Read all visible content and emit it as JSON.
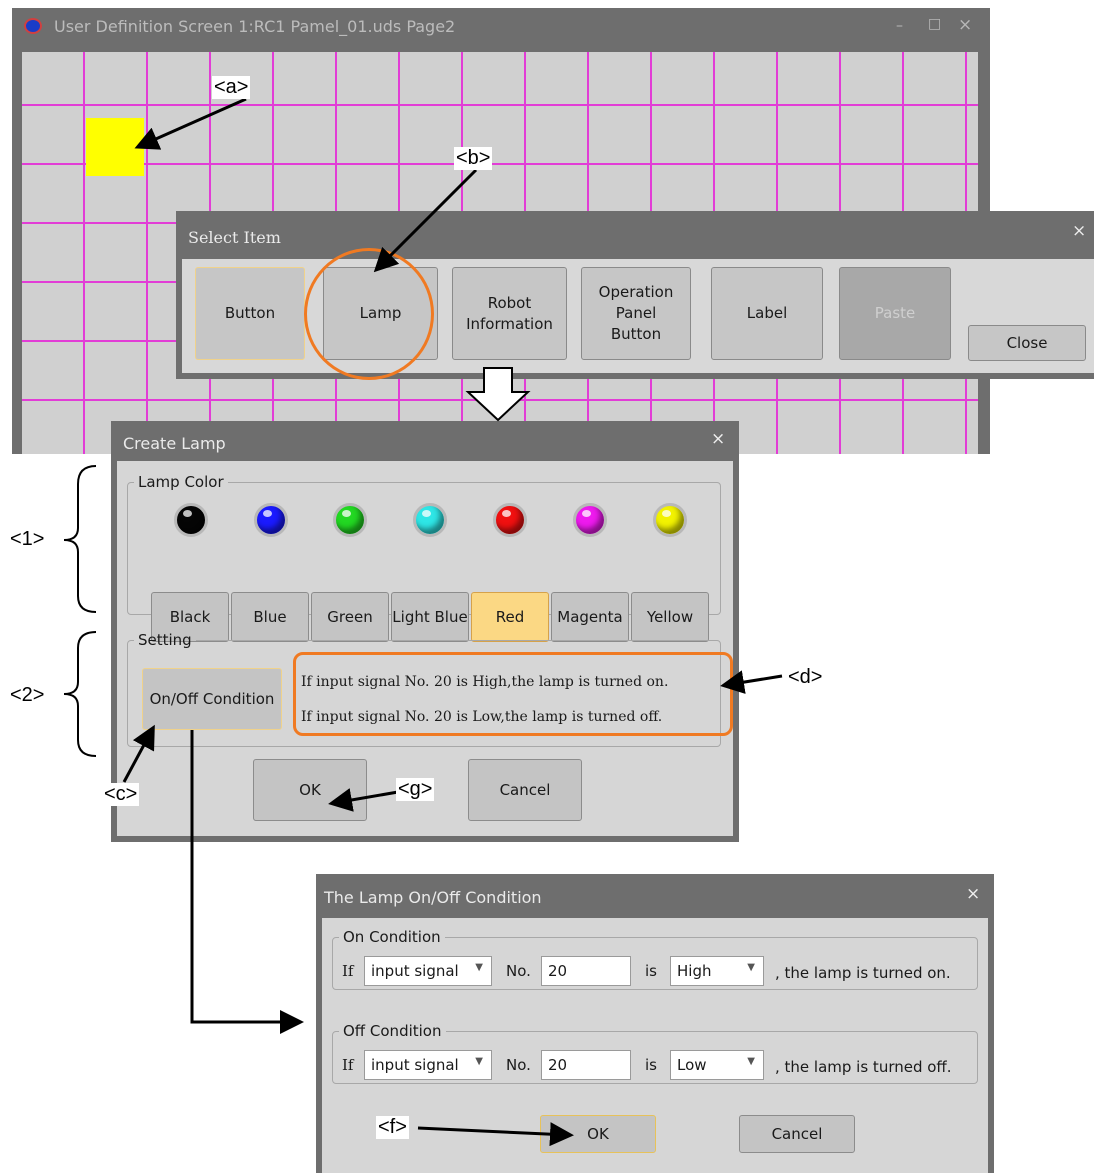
{
  "main_window": {
    "title": "User Definition Screen 1:RC1 Pamel_01.uds Page2",
    "controls": [
      "–",
      "□",
      "×"
    ]
  },
  "select_item": {
    "title": "Select Item",
    "close_x": "×",
    "buttons": [
      "Button",
      "Lamp",
      "Robot\nInformation",
      "Operation\nPanel\nButton",
      "Label",
      "Paste"
    ],
    "close": "Close"
  },
  "create_lamp": {
    "title": "Create Lamp",
    "close_x": "×",
    "lamp_color_legend": "Lamp Color",
    "colors": [
      {
        "label": "Black",
        "hex": "#050505"
      },
      {
        "label": "Blue",
        "hex": "#1a1aff"
      },
      {
        "label": "Green",
        "hex": "#22d822"
      },
      {
        "label": "Light Blue",
        "hex": "#2ee6e6"
      },
      {
        "label": "Red",
        "hex": "#f01010"
      },
      {
        "label": "Magenta",
        "hex": "#ee1aee"
      },
      {
        "label": "Yellow",
        "hex": "#f2f200"
      }
    ],
    "selected_color": "Red",
    "setting_legend": "Setting",
    "on_off_button": "On/Off Condition",
    "desc_on": "If input signal No. 20 is High,the lamp is turned on.",
    "desc_off": "If input signal No. 20 is Low,the lamp is turned off.",
    "ok": "OK",
    "cancel": "Cancel"
  },
  "condition": {
    "title": "The Lamp On/Off Condition",
    "close_x": "×",
    "on": {
      "legend": "On Condition",
      "if": "If",
      "signal": "input signal",
      "no_label": "No.",
      "no": "20",
      "is": "is",
      "level": "High",
      "tail": ", the lamp is turned on."
    },
    "off": {
      "legend": "Off Condition",
      "if": "If",
      "signal": "input signal",
      "no_label": "No.",
      "no": "20",
      "is": "is",
      "level": "Low",
      "tail": ", the lamp is turned off."
    },
    "ok": "OK",
    "cancel": "Cancel"
  },
  "annotations": {
    "a": "<a>",
    "b": "<b>",
    "c": "<c>",
    "d": "<d>",
    "f": "<f>",
    "g": "<g>",
    "one": "<1>",
    "two": "<2>"
  },
  "colors": {
    "grid_line": "#e23cd6",
    "highlight": "#f07a22",
    "window_frame": "#6e6e6e",
    "placed_lamp": "#ffff00"
  }
}
